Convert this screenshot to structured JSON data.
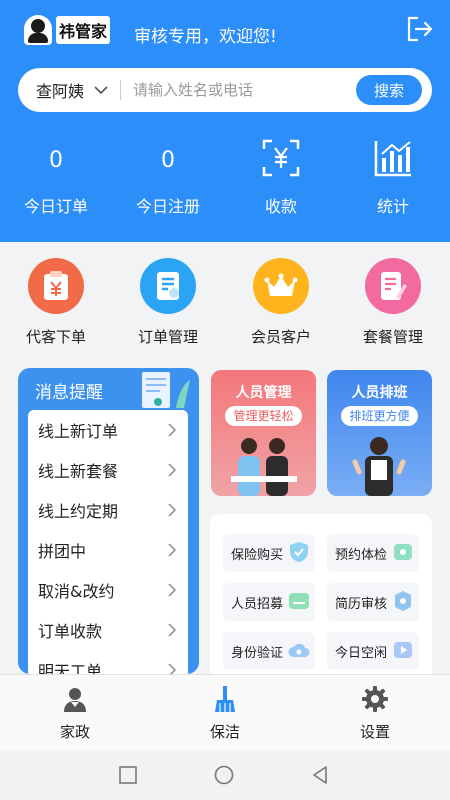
{
  "app": {
    "logo_text": "祎管家",
    "welcome": "审核专用，欢迎您!"
  },
  "search": {
    "city": "查阿姨",
    "placeholder": "请输入姓名或电话",
    "button": "搜索"
  },
  "stats": [
    {
      "value": "0",
      "label": "今日订单"
    },
    {
      "value": "0",
      "label": "今日注册"
    },
    {
      "icon": "scan-yuan-icon",
      "label": "收款"
    },
    {
      "icon": "bar-chart-icon",
      "label": "统计"
    }
  ],
  "functions": [
    {
      "label": "代客下单",
      "icon": "clipboard-yuan-icon",
      "color": "#f26a47"
    },
    {
      "label": "订单管理",
      "icon": "order-doc-icon",
      "color": "#2aa4f4"
    },
    {
      "label": "会员客户",
      "icon": "crown-icon",
      "color": "#ffb31c"
    },
    {
      "label": "套餐管理",
      "icon": "edit-doc-icon",
      "color": "#f26aa0"
    }
  ],
  "messages": {
    "title": "消息提醒",
    "items": [
      "线上新订单",
      "线上新套餐",
      "线上约定期",
      "拼团中",
      "取消&改约",
      "订单收款",
      "明天工单"
    ]
  },
  "promos": [
    {
      "title": "人员管理",
      "tag": "管理更轻松"
    },
    {
      "title": "人员排班",
      "tag": "排班更方便"
    }
  ],
  "services": [
    {
      "label": "保险购买",
      "icon": "shield-icon"
    },
    {
      "label": "预约体检",
      "icon": "checkup-icon"
    },
    {
      "label": "人员招募",
      "icon": "job-icon"
    },
    {
      "label": "简历审核",
      "icon": "resume-icon"
    },
    {
      "label": "身份验证",
      "icon": "id-cloud-icon"
    },
    {
      "label": "今日空闲",
      "icon": "play-icon"
    }
  ],
  "tabs": [
    {
      "label": "家政",
      "icon": "person-icon",
      "active": false
    },
    {
      "label": "保洁",
      "icon": "broom-icon",
      "active": true
    },
    {
      "label": "设置",
      "icon": "gear-icon",
      "active": false
    }
  ],
  "colors": {
    "primary": "#2c8ef8",
    "promo_red": "#f26b6f",
    "promo_blue": "#4a8ff0"
  }
}
